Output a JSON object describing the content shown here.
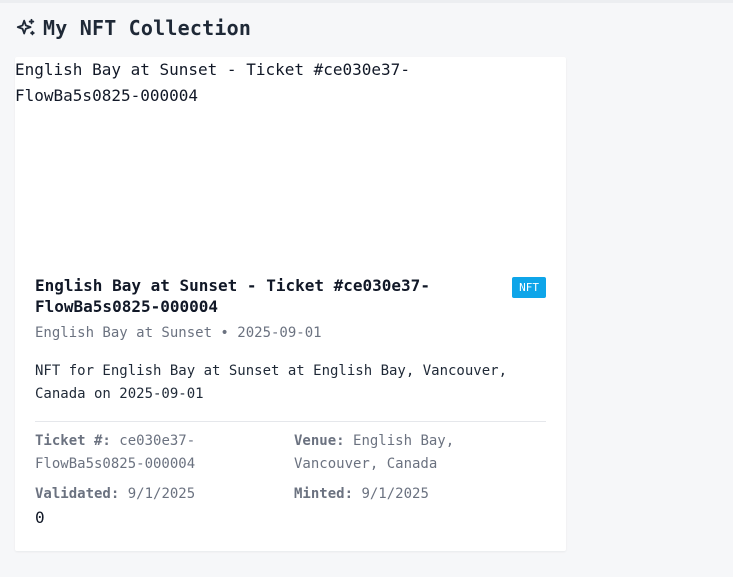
{
  "header": {
    "title": "My NFT Collection",
    "icon": "sparkles-icon"
  },
  "card": {
    "image_alt": "English Bay at Sunset - Ticket #ce030e37-FlowBa5s0825-000004",
    "title": "English Bay at Sunset - Ticket #ce030e37-FlowBa5s0825-000004",
    "badge": "NFT",
    "subtitle": "English Bay at Sunset • 2025-09-01",
    "description": "NFT for English Bay at Sunset at English Bay, Vancouver, Canada on 2025-09-01",
    "ticket_label": "Ticket #:",
    "ticket_value": "ce030e37-FlowBa5s0825-000004",
    "venue_label": "Venue:",
    "venue_value": "English Bay, Vancouver, Canada",
    "validated_label": "Validated:",
    "validated_value": "9/1/2025",
    "minted_label": "Minted:",
    "minted_value": "9/1/2025",
    "count": "0"
  },
  "colors": {
    "badge": "#0ea5e9",
    "background": "#f6f7f9",
    "card": "#ffffff"
  }
}
